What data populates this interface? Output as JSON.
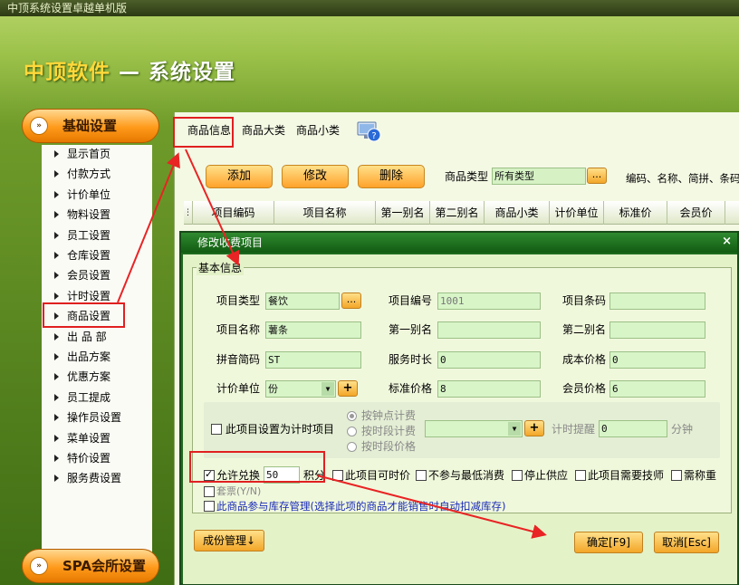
{
  "window": {
    "title": "中顶系统设置卓越单机版"
  },
  "brand": {
    "name": "中顶软件",
    "separator": " — ",
    "subtitle": "系统设置"
  },
  "sidebar": {
    "section1": "基础设置",
    "section2": "SPA会所设置",
    "knob_glyph": "»",
    "items": [
      {
        "label": "显示首页"
      },
      {
        "label": "付款方式"
      },
      {
        "label": "计价单位"
      },
      {
        "label": "物料设置"
      },
      {
        "label": "员工设置"
      },
      {
        "label": "仓库设置"
      },
      {
        "label": "会员设置"
      },
      {
        "label": "计时设置"
      },
      {
        "label": "商品设置"
      },
      {
        "label": "出 品 部"
      },
      {
        "label": "出品方案"
      },
      {
        "label": "优惠方案"
      },
      {
        "label": "员工提成"
      },
      {
        "label": "操作员设置"
      },
      {
        "label": "菜单设置"
      },
      {
        "label": "特价设置"
      },
      {
        "label": "服务费设置"
      }
    ]
  },
  "tabs": [
    {
      "label": "商品信息"
    },
    {
      "label": "商品大类"
    },
    {
      "label": "商品小类"
    }
  ],
  "toolbar": {
    "add": "添加",
    "edit": "修改",
    "delete": "删除",
    "type_label": "商品类型",
    "type_value": "所有类型",
    "dots": "...",
    "search_hint": "编码、名称、简拼、条码"
  },
  "grid": {
    "columns": [
      "项目编码",
      "项目名称",
      "第一别名",
      "第二别名",
      "商品小类",
      "计价单位",
      "标准价",
      "会员价"
    ]
  },
  "dialog": {
    "title": "修改收费项目",
    "close": "×",
    "group_title": "基本信息",
    "fields": {
      "item_type_label": "项目类型",
      "item_type_value": "餐饮",
      "item_no_label": "项目编号",
      "item_no_value": "1001",
      "barcode_label": "项目条码",
      "barcode_value": "",
      "name_label": "项目名称",
      "name_value": "薯条",
      "alias1_label": "第一别名",
      "alias1_value": "",
      "alias2_label": "第二别名",
      "alias2_value": "",
      "pinyin_label": "拼音简码",
      "pinyin_value": "ST",
      "duration_label": "服务时长",
      "duration_value": "0",
      "cost_label": "成本价格",
      "cost_value": "0",
      "unit_label": "计价单位",
      "unit_value": "份",
      "std_price_label": "标准价格",
      "std_price_value": "8",
      "member_price_label": "会员价格",
      "member_price_value": "6"
    },
    "timing": {
      "checkbox_label": "此项目设置为计时项目",
      "radio1": "按钟点计费",
      "radio2": "按时段计费",
      "radio3": "按时段价格",
      "reminder_label": "计时提醒",
      "reminder_value": "0",
      "reminder_unit": "分钟"
    },
    "options": {
      "exchange_label": "允许兑换",
      "exchange_value": "50",
      "points_label": "积分",
      "opt1": "此项目可时价",
      "opt2": "不参与最低消费",
      "opt3": "停止供应",
      "opt4": "此项目需要技师",
      "opt5": "需称重",
      "package": "套票(Y/N)",
      "inventory": "此商品参与库存管理(选择此项的商品才能销售时自动扣减库存)"
    },
    "buttons": {
      "bom": "成份管理↓",
      "ok": "确定[F9]",
      "cancel": "取消[Esc]"
    }
  }
}
